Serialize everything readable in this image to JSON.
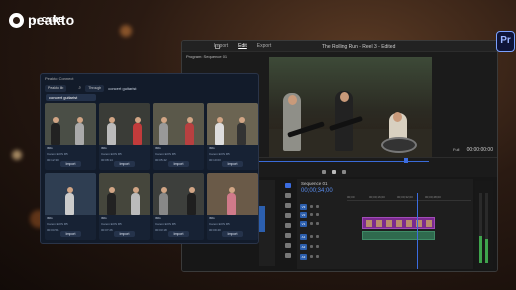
{
  "brand": {
    "name": "peakto",
    "by": "by",
    "company": "CYME"
  },
  "premiere": {
    "badge": "Pr",
    "menu": [
      "Import",
      "Edit",
      "Export"
    ],
    "active_menu": "Edit",
    "title": "The Rolling Run - Reel 3 - Edited",
    "program_label": "Program: Sequence 01",
    "fit": "Full",
    "timecode": "00:00:00:00",
    "sequence_tab": "Sequence 01",
    "sequence_timecode": "00;00;34;00",
    "ruler_marks": [
      "00;00",
      "00;00;16;00",
      "00;00;32;00",
      "00;00;48;00",
      "00;01;04;02"
    ],
    "tracks": [
      "V3",
      "V2",
      "V1",
      "A1",
      "A2",
      "A3"
    ]
  },
  "peakto": {
    "title": "Peakto Connect",
    "source_select": "Peakto lib",
    "filter_select": "Through",
    "search_label": "concert guitarist",
    "search_value": "concert guitarist",
    "cards": [
      {
        "l1": "IMG",
        "l2": "Canon EOS R5",
        "l3": "00:12:30",
        "import": "Import"
      },
      {
        "l1": "IMG",
        "l2": "Canon EOS R5",
        "l3": "00:08:14",
        "import": "Import"
      },
      {
        "l1": "IMG",
        "l2": "Canon EOS R5",
        "l3": "00:05:42",
        "import": "Import"
      },
      {
        "l1": "IMG",
        "l2": "Canon EOS R5",
        "l3": "00:10:03",
        "import": "Import"
      },
      {
        "l1": "IMG",
        "l2": "Canon EOS R5",
        "l3": "00:04:51",
        "import": "Import"
      },
      {
        "l1": "IMG",
        "l2": "Canon EOS R5",
        "l3": "00:07:26",
        "import": "Import"
      },
      {
        "l1": "IMG",
        "l2": "Canon EOS R5",
        "l3": "00:03:18",
        "import": "Import"
      },
      {
        "l1": "IMG",
        "l2": "Canon EOS R5",
        "l3": "00:09:40",
        "import": "Import"
      }
    ]
  },
  "colors": {
    "accent": "#3b6ce0",
    "clip_video": "#7a2a8f",
    "panel_bg": "#121b2a"
  }
}
